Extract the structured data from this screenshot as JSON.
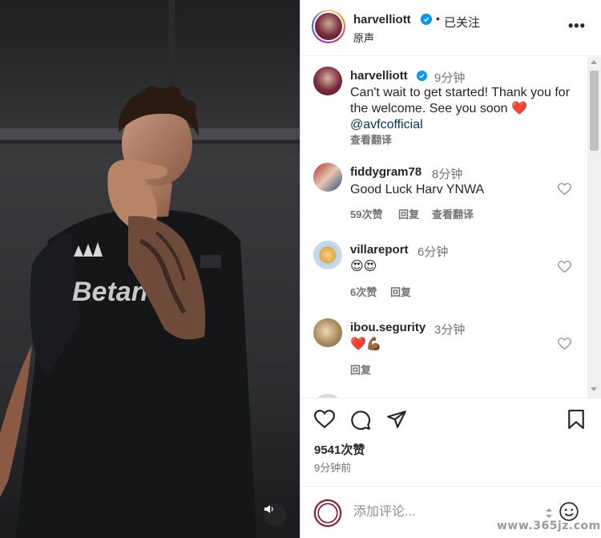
{
  "post": {
    "username": "harvelliott",
    "follow_status": "已关注",
    "audio_label": "原声",
    "more_icon": "more-icon"
  },
  "caption": {
    "username": "harvelliott",
    "time": "9分钟",
    "text": "Can't wait to get started! Thank you for the welcome. See you soon ❤️",
    "mention": "@avfcofficial",
    "translate": "查看翻译"
  },
  "comments": [
    {
      "username": "fiddygram78",
      "time": "8分钟",
      "text": "Good Luck Harv YNWA",
      "likes": "59次赞",
      "reply": "回复",
      "translate": "查看翻译"
    },
    {
      "username": "villareport",
      "time": "6分钟",
      "text": "😍😍",
      "likes": "6次赞",
      "reply": "回复"
    },
    {
      "username": "ibou.segurity",
      "time": "3分钟",
      "text": "❤️💪🏾",
      "reply": "回复"
    }
  ],
  "actions": {
    "likes_count": "9541次赞",
    "posted_time": "9分钟前"
  },
  "add_comment": {
    "placeholder": "添加评论..."
  },
  "watermark": "www.365jz.com",
  "colors": {
    "verified": "#0095f6",
    "heart": "#ed4956",
    "link": "#00376b",
    "muted": "#737373"
  }
}
